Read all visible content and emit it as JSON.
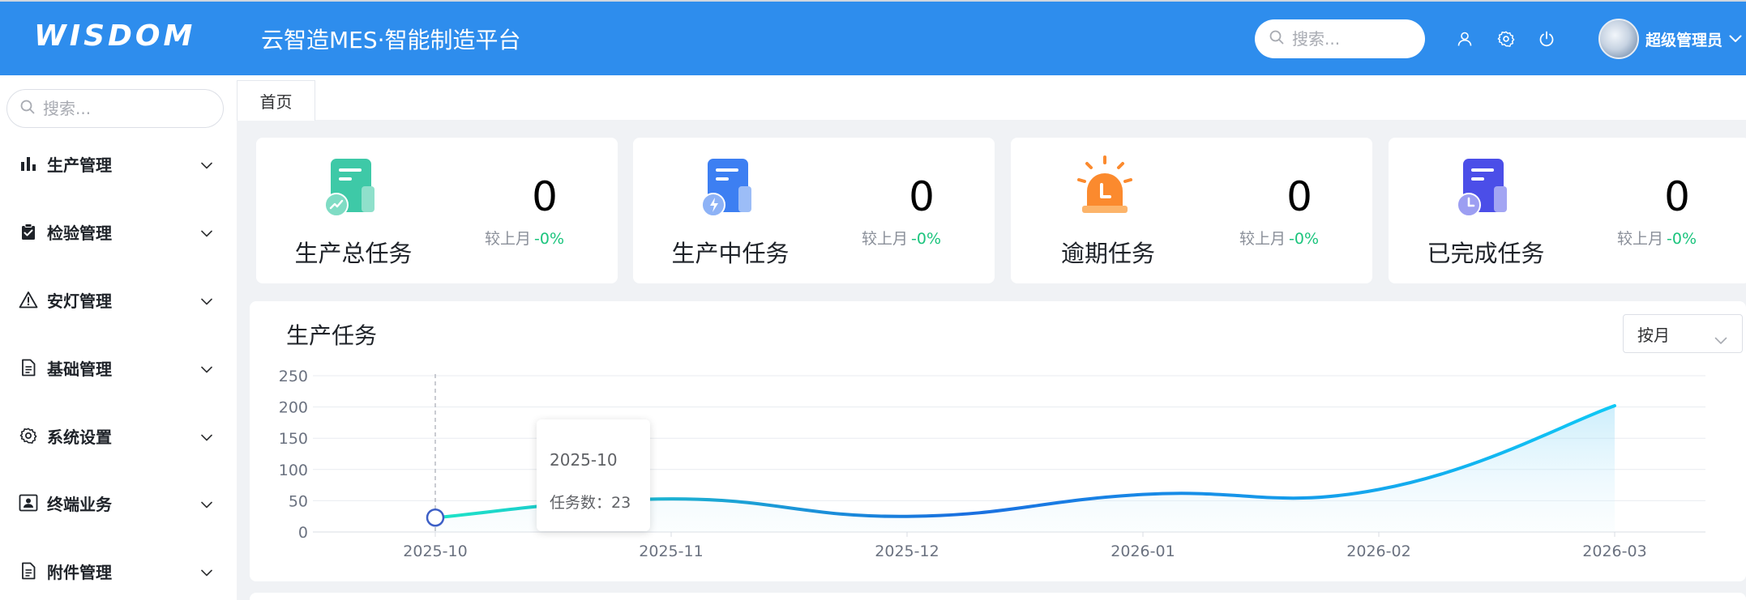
{
  "header": {
    "logo_text": "WISDOM",
    "app_title": "云智造MES·智能制造平台",
    "search_placeholder": "搜索...",
    "user_name": "超级管理员",
    "background_color": "#2e8ded",
    "icons": [
      "user-icon",
      "gear-icon",
      "power-icon",
      "search-icon",
      "chevron-down-icon"
    ]
  },
  "sidebar": {
    "search_placeholder": "搜索...",
    "items": [
      {
        "label": "生产管理",
        "icon": "bar-chart-icon"
      },
      {
        "label": "检验管理",
        "icon": "clipboard-check-icon"
      },
      {
        "label": "安灯管理",
        "icon": "warning-icon"
      },
      {
        "label": "基础管理",
        "icon": "document-icon"
      },
      {
        "label": "系统设置",
        "icon": "gear-icon"
      },
      {
        "label": "终端业务",
        "icon": "terminal-user-icon"
      },
      {
        "label": "附件管理",
        "icon": "document-icon"
      }
    ]
  },
  "tabs": [
    {
      "label": "首页",
      "active": true
    }
  ],
  "stats": [
    {
      "label": "生产总任务",
      "value": "0",
      "compare_label": "较上月",
      "compare_value": "-0%",
      "icon": "task-total-icon",
      "color": "#3ec9a7"
    },
    {
      "label": "生产中任务",
      "value": "0",
      "compare_label": "较上月",
      "compare_value": "-0%",
      "icon": "task-running-icon",
      "color": "#3d7ff2"
    },
    {
      "label": "逾期任务",
      "value": "0",
      "compare_label": "较上月",
      "compare_value": "-0%",
      "icon": "alarm-icon",
      "color": "#fb8a2e"
    },
    {
      "label": "已完成任务",
      "value": "0",
      "compare_label": "较上月",
      "compare_value": "-0%",
      "icon": "task-done-icon",
      "color": "#4b4ee8"
    }
  ],
  "chart_panel": {
    "title": "生产任务",
    "period_select": "按月"
  },
  "tooltip": {
    "title": "2025-10",
    "label": "任务数：",
    "value": "23"
  },
  "chart_data": {
    "type": "area",
    "categories": [
      "2025-10",
      "2025-11",
      "2025-12",
      "2026-01",
      "2026-02",
      "2026-03"
    ],
    "series": [
      {
        "values": [
          23,
          53,
          25,
          60,
          68,
          202
        ]
      }
    ],
    "ylim": [
      0,
      250
    ],
    "yticks": [
      0,
      50,
      100,
      150,
      200,
      250
    ],
    "grid": true,
    "line_gradient": [
      "#1de5c7",
      "#1a6fe0",
      "#10c8f5"
    ],
    "highlighted_index": 0
  }
}
